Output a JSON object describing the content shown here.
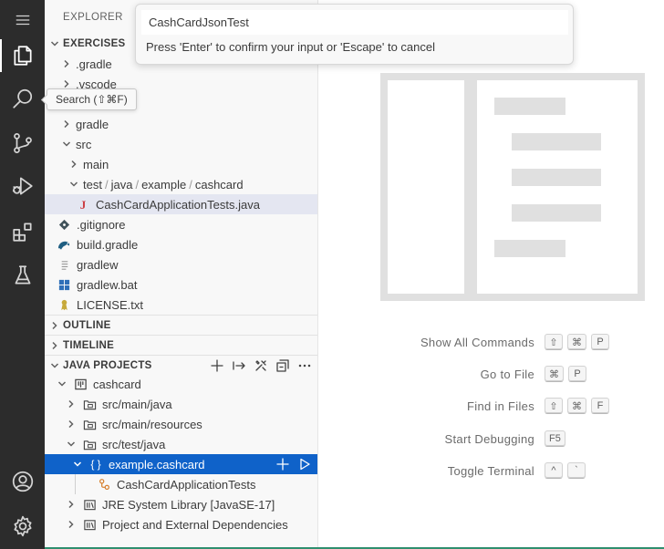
{
  "activity_bar": {
    "items": [
      {
        "name": "menu",
        "icon": "hamburger-icon"
      },
      {
        "name": "explorer",
        "icon": "files-icon",
        "active": true
      },
      {
        "name": "search",
        "icon": "search-icon"
      },
      {
        "name": "source-control",
        "icon": "source-control-icon"
      },
      {
        "name": "run-debug",
        "icon": "run-debug-icon"
      },
      {
        "name": "extensions",
        "icon": "extensions-icon"
      },
      {
        "name": "testing",
        "icon": "flask-icon"
      },
      {
        "name": "accounts",
        "icon": "account-icon"
      },
      {
        "name": "manage",
        "icon": "gear-icon"
      }
    ]
  },
  "tooltip": {
    "text": "Search (⇧⌘F)"
  },
  "quick_input": {
    "value": "CashCardJsonTest",
    "message": "Press 'Enter' to confirm your input or 'Escape' to cancel"
  },
  "sidebar": {
    "title": "EXPLORER",
    "exercises": {
      "header": "EXERCISES",
      "items": [
        {
          "label": ".gradle"
        },
        {
          "label": ".vscode"
        },
        {
          "label": "gradle"
        },
        {
          "label": "src"
        },
        {
          "label": "main"
        },
        {
          "path": [
            "test",
            "java",
            "example",
            "cashcard"
          ]
        },
        {
          "label": "CashCardApplicationTests.java"
        },
        {
          "label": ".gitignore"
        },
        {
          "label": "build.gradle"
        },
        {
          "label": "gradlew"
        },
        {
          "label": "gradlew.bat"
        },
        {
          "label": "LICENSE.txt"
        }
      ]
    },
    "outline": {
      "header": "OUTLINE"
    },
    "timeline": {
      "header": "TIMELINE"
    },
    "java_projects": {
      "header": "JAVA PROJECTS",
      "items": [
        {
          "label": "cashcard"
        },
        {
          "label": "src/main/java"
        },
        {
          "label": "src/main/resources"
        },
        {
          "label": "src/test/java"
        },
        {
          "label": "example.cashcard"
        },
        {
          "label": "CashCardApplicationTests"
        },
        {
          "label": "JRE System Library [JavaSE-17]"
        },
        {
          "label": "Project and External Dependencies"
        }
      ]
    }
  },
  "editor": {
    "shortcuts": [
      {
        "label": "Show All Commands",
        "keys": [
          "⇧",
          "⌘",
          "P"
        ]
      },
      {
        "label": "Go to File",
        "keys": [
          "⌘",
          "P"
        ]
      },
      {
        "label": "Find in Files",
        "keys": [
          "⇧",
          "⌘",
          "F"
        ]
      },
      {
        "label": "Start Debugging",
        "keys": [
          "F5"
        ]
      },
      {
        "label": "Toggle Terminal",
        "keys": [
          "^",
          "`"
        ]
      }
    ]
  },
  "colors": {
    "activity_bar": "#2c2c2c",
    "sidebar": "#f8f8f8",
    "selection": "#0f62c9",
    "highlight": "#e4e6f1",
    "status_line": "#2f8f6f"
  }
}
